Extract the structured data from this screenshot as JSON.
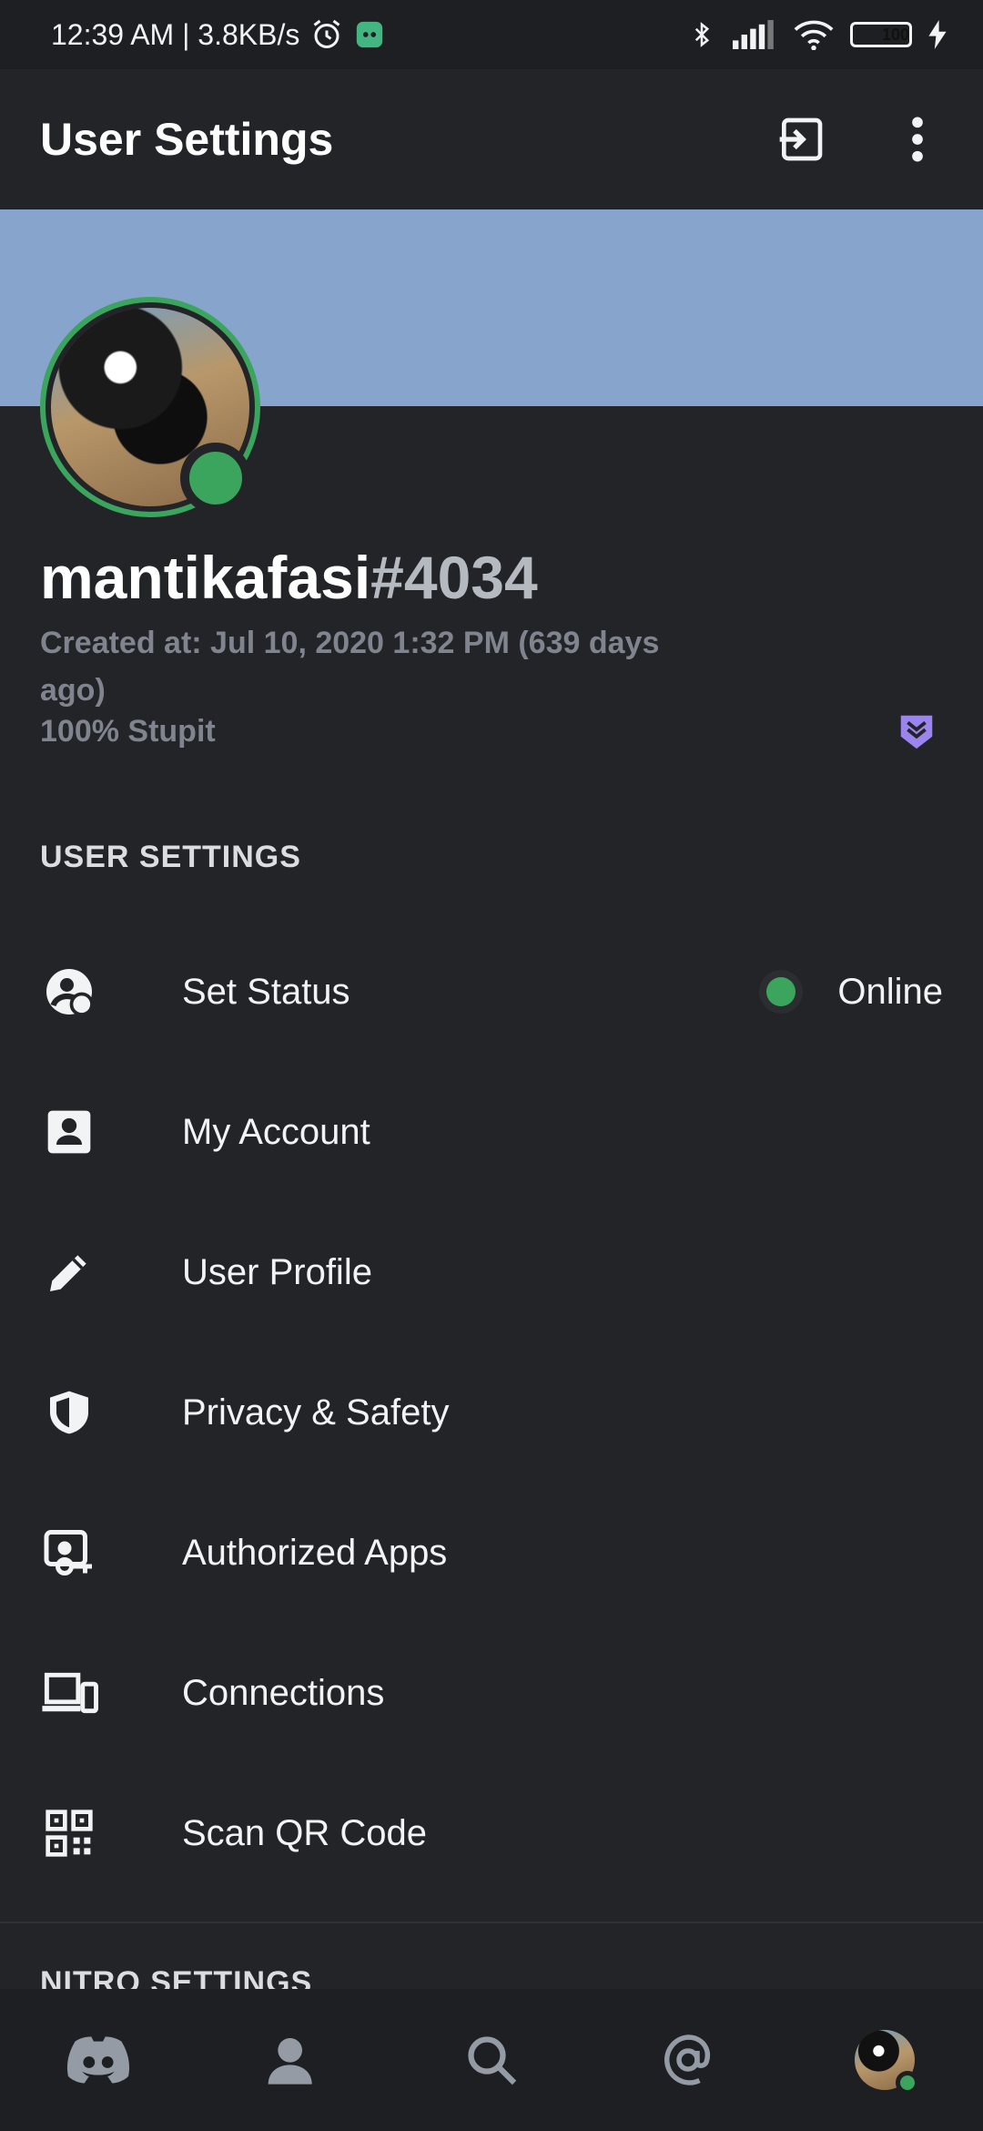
{
  "status_bar": {
    "time_speed": "12:39 AM | 3.8KB/s",
    "battery": "100"
  },
  "app_bar": {
    "title": "User Settings"
  },
  "profile": {
    "username": "mantikafasi",
    "discriminator": "#4034",
    "created": "Created at: Jul 10, 2020 1:32 PM (639 days ago)",
    "bio": "100% Stupit",
    "status_color": "#3ba55d",
    "banner_color": "#87a4cd"
  },
  "sections": {
    "user_settings_header": "USER SETTINGS",
    "nitro_settings_header": "NITRO SETTINGS"
  },
  "settings_items": [
    {
      "label": "Set Status",
      "icon": "status-icon",
      "value": "Online"
    },
    {
      "label": "My Account",
      "icon": "account-icon"
    },
    {
      "label": "User Profile",
      "icon": "pencil-icon"
    },
    {
      "label": "Privacy & Safety",
      "icon": "shield-icon"
    },
    {
      "label": "Authorized Apps",
      "icon": "authorized-apps-icon"
    },
    {
      "label": "Connections",
      "icon": "devices-icon"
    },
    {
      "label": "Scan QR Code",
      "icon": "qr-code-icon"
    }
  ],
  "bottom_nav": [
    "discord-home-icon",
    "friends-icon",
    "search-icon",
    "mentions-icon",
    "profile-avatar"
  ]
}
